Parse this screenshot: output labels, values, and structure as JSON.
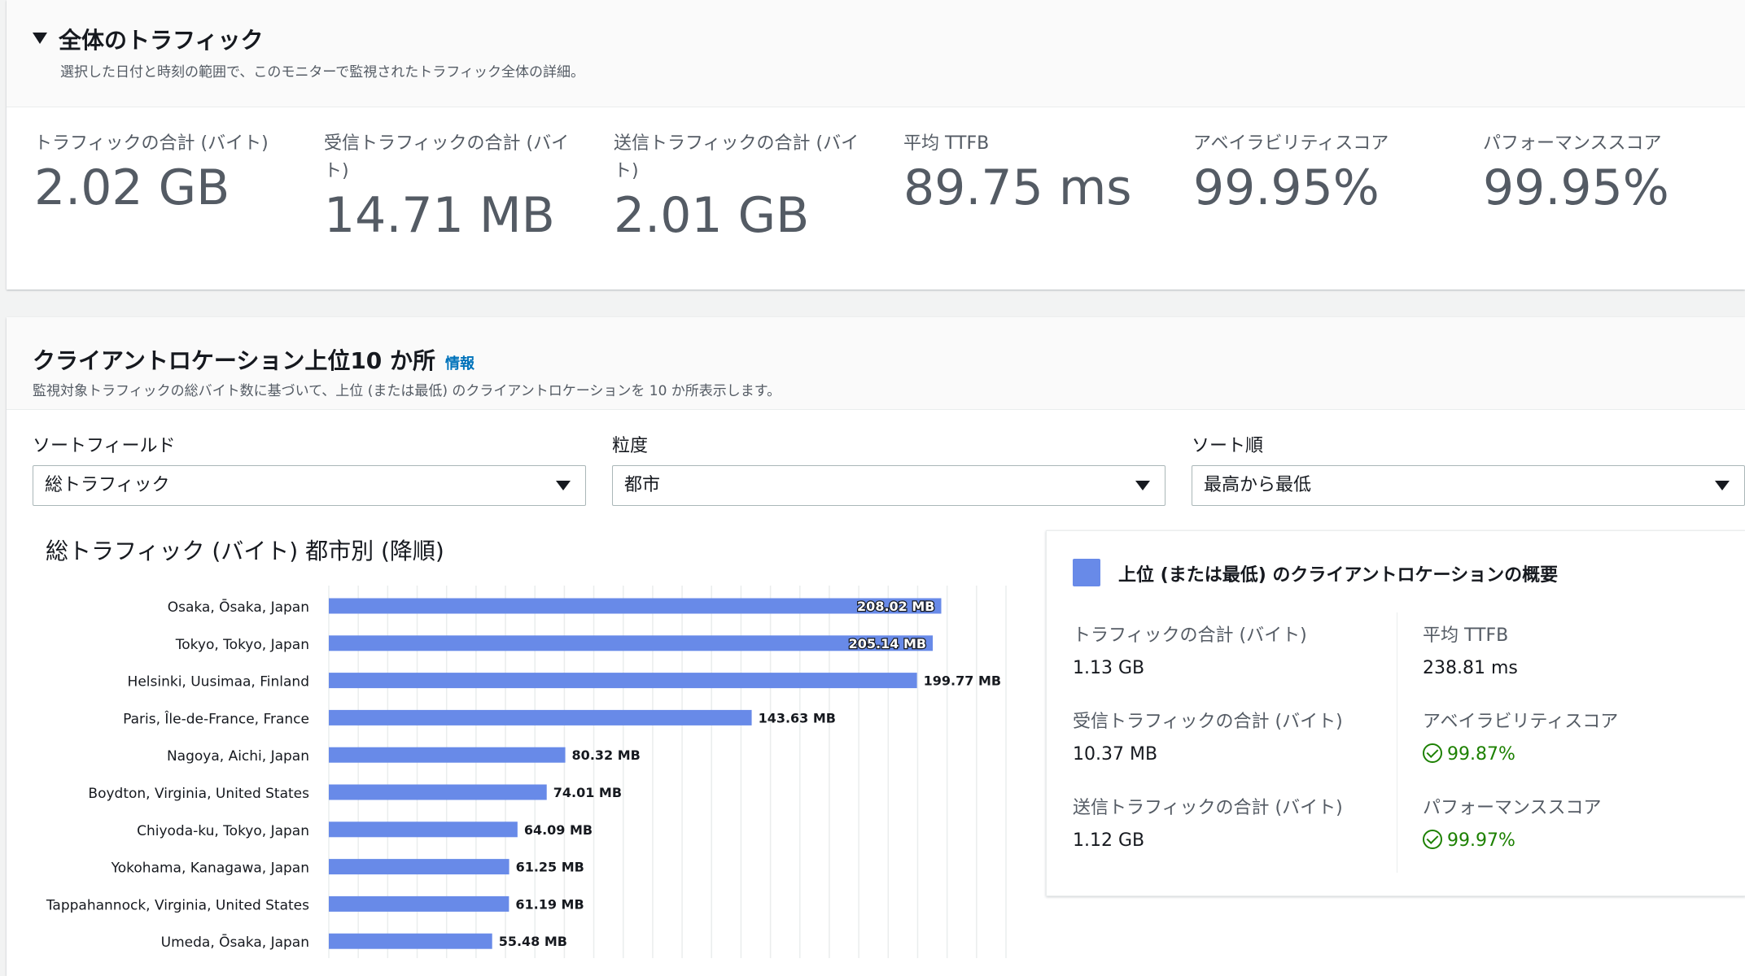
{
  "overall": {
    "title": "全体のトラフィック",
    "description": "選択した日付と時刻の範囲で、このモニターで監視されたトラフィック全体の詳細。",
    "metrics": [
      {
        "label": "トラフィックの合計 (バイト)",
        "value": "2.02 GB"
      },
      {
        "label": "受信トラフィックの合計 (バイト)",
        "value": "14.71 MB"
      },
      {
        "label": "送信トラフィックの合計 (バイト)",
        "value": "2.01 GB"
      },
      {
        "label": "平均 TTFB",
        "value": "89.75 ms"
      },
      {
        "label": "アベイラビリティスコア",
        "value": "99.95%"
      },
      {
        "label": "パフォーマンススコア",
        "value": "99.95%"
      }
    ]
  },
  "top10": {
    "title": "クライアントロケーション上位10 か所",
    "info_link": "情報",
    "description": "監視対象トラフィックの総バイト数に基づいて、上位 (または最低) のクライアントロケーションを 10 か所表示します。",
    "fields": {
      "sort_field": {
        "label": "ソートフィールド",
        "value": "総トラフィック"
      },
      "granularity": {
        "label": "粒度",
        "value": "都市"
      },
      "sort_order": {
        "label": "ソート順",
        "value": "最高から最低"
      }
    },
    "chart_title": "総トラフィック (バイト) 都市別 (降順)"
  },
  "chart_data": {
    "type": "bar",
    "orientation": "horizontal",
    "title": "総トラフィック (バイト) 都市別 (降順)",
    "unit": "MB",
    "color": "#688ae8",
    "categories": [
      "Osaka, Ōsaka, Japan",
      "Tokyo, Tokyo, Japan",
      "Helsinki, Uusimaa, Finland",
      "Paris, Île-de-France, France",
      "Nagoya, Aichi, Japan",
      "Boydton, Virginia, United States",
      "Chiyoda-ku, Tokyo, Japan",
      "Yokohama, Kanagawa, Japan",
      "Tappahannock, Virginia, United States",
      "Umeda, Ōsaka, Japan"
    ],
    "values": [
      208.02,
      205.14,
      199.77,
      143.63,
      80.32,
      74.01,
      64.09,
      61.25,
      61.19,
      55.48
    ],
    "value_labels": [
      "208.02 MB",
      "205.14 MB",
      "199.77 MB",
      "143.63 MB",
      "80.32 MB",
      "74.01 MB",
      "64.09 MB",
      "61.25 MB",
      "61.19 MB",
      "55.48 MB"
    ],
    "xlim": [
      0,
      230
    ],
    "grid": true
  },
  "summary": {
    "title": "上位 (または最低) のクライアントロケーションの概要",
    "legend_color": "#688ae8",
    "left": [
      {
        "label": "トラフィックの合計 (バイト)",
        "value": "1.13 GB"
      },
      {
        "label": "受信トラフィックの合計 (バイト)",
        "value": "10.37 MB"
      },
      {
        "label": "送信トラフィックの合計 (バイト)",
        "value": "1.12 GB"
      }
    ],
    "right": [
      {
        "label": "平均 TTFB",
        "value": "238.81 ms"
      },
      {
        "label": "アベイラビリティスコア",
        "value": "99.87%",
        "status": "success"
      },
      {
        "label": "パフォーマンススコア",
        "value": "99.97%",
        "status": "success"
      }
    ]
  }
}
